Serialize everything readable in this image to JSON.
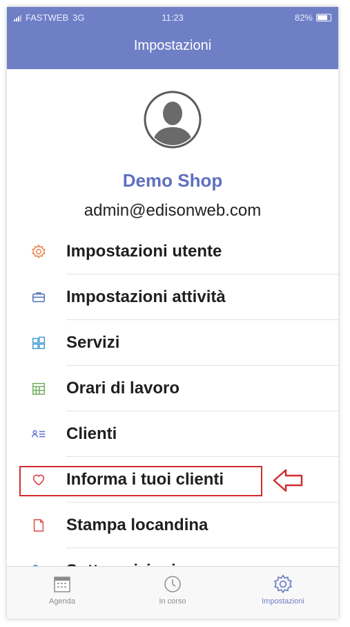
{
  "status_bar": {
    "carrier": "FASTWEB",
    "network": "3G",
    "time": "11:23",
    "battery": "82%",
    "battery_level": 0.82
  },
  "header": {
    "title": "Impostazioni"
  },
  "profile": {
    "name": "Demo Shop",
    "email": "admin@edisonweb.com"
  },
  "menu": [
    {
      "label": "Impostazioni utente",
      "icon": "gear-icon",
      "color": "#e8804a"
    },
    {
      "label": "Impostazioni attività",
      "icon": "briefcase-icon",
      "color": "#4a6fb5"
    },
    {
      "label": "Servizi",
      "icon": "grid-icon",
      "color": "#3f9ad6"
    },
    {
      "label": "Orari di lavoro",
      "icon": "calendar-icon",
      "color": "#6fae5a"
    },
    {
      "label": "Clienti",
      "icon": "contacts-icon",
      "color": "#5a6fd0"
    },
    {
      "label": "Informa i tuoi clienti",
      "icon": "heart-icon",
      "color": "#d8434e"
    },
    {
      "label": "Stampa locandina",
      "icon": "document-icon",
      "color": "#e05a5a"
    },
    {
      "label": "Sottoscrizioni",
      "icon": "key-icon",
      "color": "#4a8fc4"
    }
  ],
  "tabs": [
    {
      "label": "Agenda",
      "icon": "calendar-icon"
    },
    {
      "label": "In corso",
      "icon": "clock-icon"
    },
    {
      "label": "Impostazioni",
      "icon": "gear-icon",
      "active": true
    }
  ],
  "colors": {
    "accent": "#6f7fc6",
    "highlight": "#d12b2b"
  }
}
